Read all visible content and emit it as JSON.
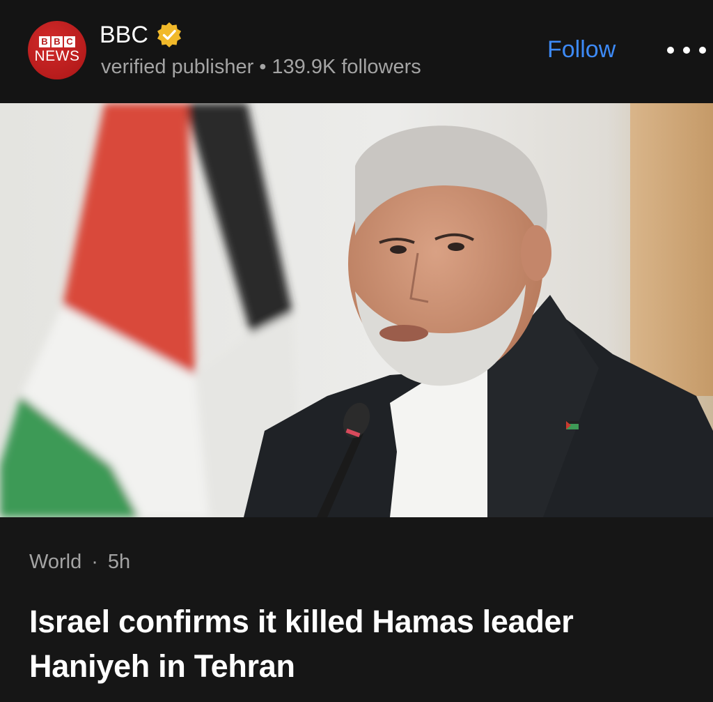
{
  "publisher": {
    "logo_top": [
      "B",
      "B",
      "C"
    ],
    "logo_bottom": "NEWS",
    "name": "BBC",
    "badge_icon": "verified-check-icon",
    "type": "verified publisher",
    "separator": "•",
    "followers": "139.9K followers"
  },
  "actions": {
    "follow_label": "Follow",
    "more_icon": "more-dots-icon"
  },
  "article": {
    "category": "World",
    "separator": "·",
    "age": "5h",
    "headline": "Israel confirms it killed Hamas leader Haniyeh in Tehran"
  },
  "colors": {
    "background": "#161616",
    "accent_blue": "#3d8af7",
    "muted_text": "#a4a4a4",
    "badge_gold": "#f1b92a",
    "bbc_red": "#b71c1c"
  }
}
